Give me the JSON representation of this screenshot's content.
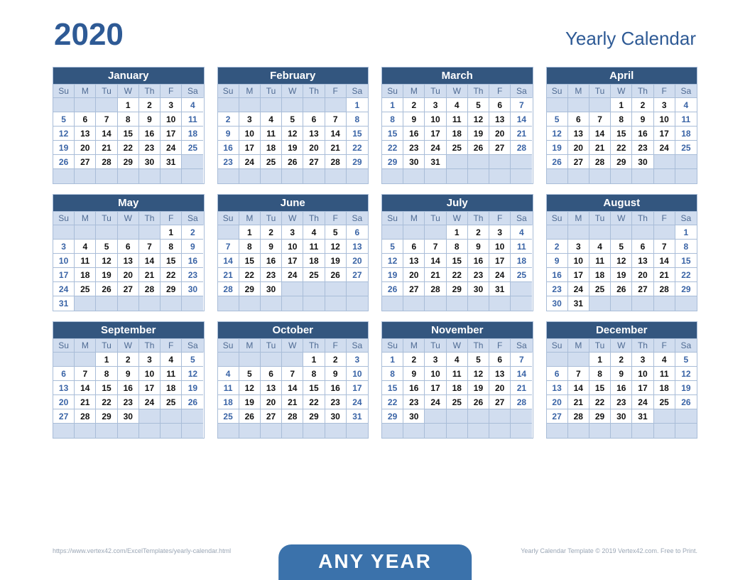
{
  "header": {
    "year": "2020",
    "title": "Yearly Calendar"
  },
  "dow": [
    "Su",
    "M",
    "Tu",
    "W",
    "Th",
    "F",
    "Sa"
  ],
  "months": [
    {
      "name": "January",
      "start": 3,
      "days": 31
    },
    {
      "name": "February",
      "start": 6,
      "days": 29
    },
    {
      "name": "March",
      "start": 0,
      "days": 31
    },
    {
      "name": "April",
      "start": 3,
      "days": 30
    },
    {
      "name": "May",
      "start": 5,
      "days": 31
    },
    {
      "name": "June",
      "start": 1,
      "days": 30
    },
    {
      "name": "July",
      "start": 3,
      "days": 31
    },
    {
      "name": "August",
      "start": 6,
      "days": 31
    },
    {
      "name": "September",
      "start": 2,
      "days": 30
    },
    {
      "name": "October",
      "start": 4,
      "days": 31
    },
    {
      "name": "November",
      "start": 0,
      "days": 30
    },
    {
      "name": "December",
      "start": 2,
      "days": 31
    }
  ],
  "footer": {
    "left": "https://www.vertex42.com/ExcelTemplates/yearly-calendar.html",
    "right": "Yearly Calendar Template © 2019 Vertex42.com. Free to Print."
  },
  "tab_label": "ANY YEAR"
}
